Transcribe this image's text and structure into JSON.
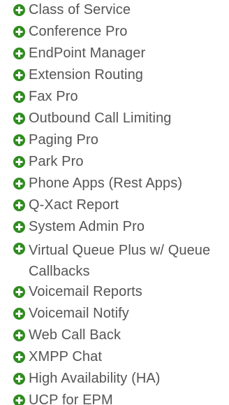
{
  "accent_color": "#2f8c1f",
  "text_color": "#555555",
  "bullet_icon": "plus-circle-icon",
  "modules": [
    {
      "label": "Class of Service"
    },
    {
      "label": "Conference Pro"
    },
    {
      "label": "EndPoint Manager"
    },
    {
      "label": "Extension Routing"
    },
    {
      "label": "Fax Pro"
    },
    {
      "label": "Outbound Call Limiting"
    },
    {
      "label": "Paging Pro"
    },
    {
      "label": "Park Pro"
    },
    {
      "label": "Phone Apps (Rest Apps)"
    },
    {
      "label": "Q-Xact Report"
    },
    {
      "label": "System Admin Pro"
    },
    {
      "label": "Virtual Queue Plus w/ Queue Callbacks"
    },
    {
      "label": "Voicemail Reports"
    },
    {
      "label": "Voicemail Notify"
    },
    {
      "label": "Web Call Back"
    },
    {
      "label": "XMPP Chat"
    },
    {
      "label": "High Availability (HA)"
    },
    {
      "label": "UCP for EPM"
    }
  ]
}
